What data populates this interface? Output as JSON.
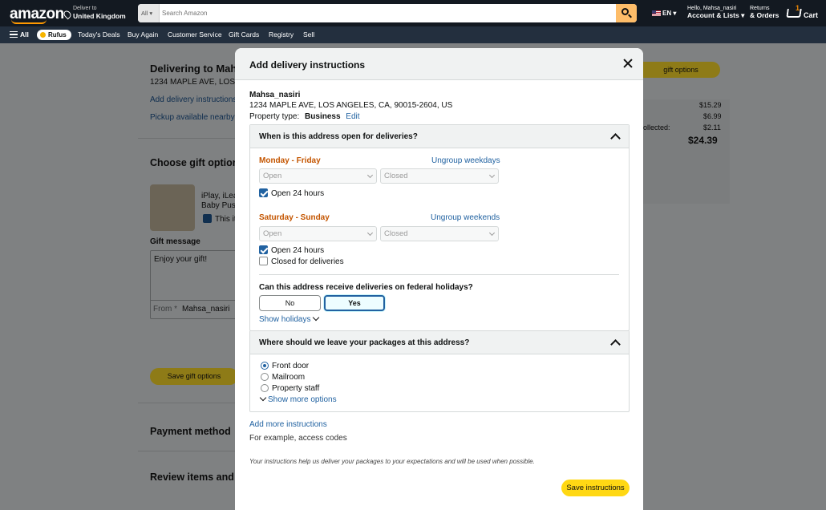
{
  "header": {
    "logo": "amazon",
    "deliver_line1": "Deliver to",
    "deliver_line2": "United Kingdom",
    "search_category": "All",
    "search_placeholder": "Search Amazon",
    "language": "EN",
    "account_line1": "Hello, Mahsa_nasiri",
    "account_line2": "Account & Lists",
    "returns_line1": "Returns",
    "returns_line2": "& Orders",
    "cart_count": "1",
    "cart_label": "Cart"
  },
  "subnav": {
    "all": "All",
    "rufus": "Rufus",
    "items": [
      "Today's Deals",
      "Buy Again",
      "Customer Service",
      "Gift Cards",
      "Registry",
      "Sell"
    ]
  },
  "background": {
    "delivering_to": "Delivering to Mahs",
    "address_short": "1234 MAPLE AVE, LOS A",
    "add_delivery_instructions": "Add delivery instructions",
    "pickup": "Pickup available nearby",
    "choose_gift": "Choose gift option",
    "product_line1": "iPlay, iLea",
    "product_line2": "Baby Push",
    "product_line3": "This it",
    "gift_message_label": "Gift message",
    "gift_message_value": "Enjoy your gift!",
    "from_label": "From *",
    "from_value": "Mahsa_nasiri",
    "save_gift_options": "Save gift options",
    "payment_method": "Payment method",
    "review_items": "Review items and s",
    "right_button": "gift options",
    "summary_values": [
      "$15.29",
      "$6.99",
      "$2.11"
    ],
    "summary_partial_label": "ollected:",
    "summary_total": "$24.39"
  },
  "modal": {
    "title": "Add delivery instructions",
    "name": "Mahsa_nasiri",
    "address": "1234 MAPLE AVE, LOS ANGELES, CA, 90015-2604, US",
    "property_type_label": "Property type:",
    "property_type_value": "Business",
    "edit_link": "Edit",
    "section1_title": "When is this address open for deliveries?",
    "weekdays_label": "Monday - Friday",
    "ungroup_weekdays": "Ungroup weekdays",
    "weekdays_open_placeholder": "Open",
    "weekdays_closed_placeholder": "Closed",
    "weekdays_open24": "Open 24 hours",
    "weekend_label": "Saturday - Sunday",
    "ungroup_weekends": "Ungroup weekends",
    "weekend_open_placeholder": "Open",
    "weekend_closed_placeholder": "Closed",
    "weekend_open24": "Open 24 hours",
    "weekend_closed_for_deliveries": "Closed for deliveries",
    "federal_question": "Can this address receive deliveries on federal holidays?",
    "federal_no": "No",
    "federal_yes": "Yes",
    "show_holidays": "Show holidays",
    "section2_title": "Where should we leave your packages at this address?",
    "options": [
      "Front door",
      "Mailroom",
      "Property staff"
    ],
    "show_more_options": "Show more options",
    "add_more_instructions": "Add more instructions",
    "for_example": "For example, access codes",
    "disclaimer": "Your instructions help us deliver your packages to your expectations and will be used when possible.",
    "save_button": "Save instructions"
  },
  "colors": {
    "nav_dark": "#131921",
    "subnav": "#232f3e",
    "accent_orange": "#c45500",
    "link_blue": "#2162a1",
    "button_yellow": "#ffd814"
  }
}
